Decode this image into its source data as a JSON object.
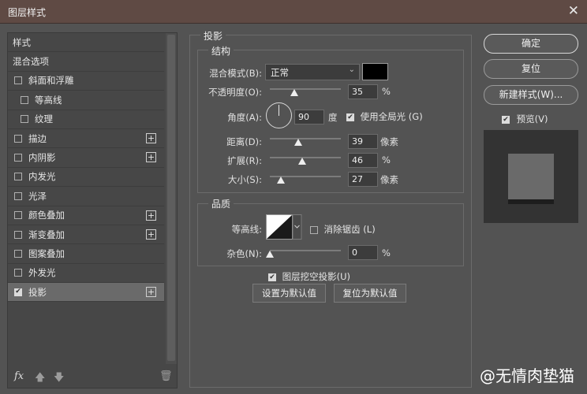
{
  "window": {
    "title": "图层样式",
    "close_label": "✕"
  },
  "left": {
    "items": [
      {
        "label": "样式",
        "checkbox": null,
        "plus": false,
        "indent": false
      },
      {
        "label": "混合选项",
        "checkbox": null,
        "plus": false,
        "indent": false
      },
      {
        "label": "斜面和浮雕",
        "checkbox": false,
        "plus": false,
        "indent": false
      },
      {
        "label": "等高线",
        "checkbox": false,
        "plus": false,
        "indent": true
      },
      {
        "label": "纹理",
        "checkbox": false,
        "plus": false,
        "indent": true
      },
      {
        "label": "描边",
        "checkbox": false,
        "plus": true,
        "indent": false
      },
      {
        "label": "内阴影",
        "checkbox": false,
        "plus": true,
        "indent": false
      },
      {
        "label": "内发光",
        "checkbox": false,
        "plus": false,
        "indent": false
      },
      {
        "label": "光泽",
        "checkbox": false,
        "plus": false,
        "indent": false
      },
      {
        "label": "颜色叠加",
        "checkbox": false,
        "plus": true,
        "indent": false
      },
      {
        "label": "渐变叠加",
        "checkbox": false,
        "plus": true,
        "indent": false
      },
      {
        "label": "图案叠加",
        "checkbox": false,
        "plus": false,
        "indent": false
      },
      {
        "label": "外发光",
        "checkbox": false,
        "plus": false,
        "indent": false
      },
      {
        "label": "投影",
        "checkbox": true,
        "plus": true,
        "indent": false,
        "selected": true
      }
    ],
    "footer": {
      "fx_label": "fx",
      "up_icon": "arrow-up-icon",
      "down_icon": "arrow-down-icon",
      "trash_icon": "trash-icon"
    }
  },
  "drop_shadow": {
    "section_title": "投影",
    "structure": {
      "title": "结构",
      "blend_mode_label": "混合模式(B):",
      "blend_mode_value": "正常",
      "shadow_color": "#000000",
      "opacity_label": "不透明度(O):",
      "opacity_value": "35",
      "opacity_unit": "%",
      "angle_label": "角度(A):",
      "angle_value": "90",
      "angle_unit": "度",
      "global_light_label": "使用全局光 (G)",
      "global_light_checked": true,
      "distance_label": "距离(D):",
      "distance_value": "39",
      "distance_unit": "像素",
      "spread_label": "扩展(R):",
      "spread_value": "46",
      "spread_unit": "%",
      "size_label": "大小(S):",
      "size_value": "27",
      "size_unit": "像素"
    },
    "quality": {
      "title": "品质",
      "contour_label": "等高线:",
      "antialias_label": "消除锯齿 (L)",
      "antialias_checked": false,
      "noise_label": "杂色(N):",
      "noise_value": "0",
      "noise_unit": "%"
    },
    "knockout_label": "图层挖空投影(U)",
    "knockout_checked": true,
    "set_default_label": "设置为默认值",
    "reset_default_label": "复位为默认值"
  },
  "right": {
    "ok_label": "确定",
    "reset_label": "复位",
    "new_style_label": "新建样式(W)...",
    "preview_label": "预览(V)",
    "preview_checked": true
  },
  "watermark": "@无情肉垫猫"
}
